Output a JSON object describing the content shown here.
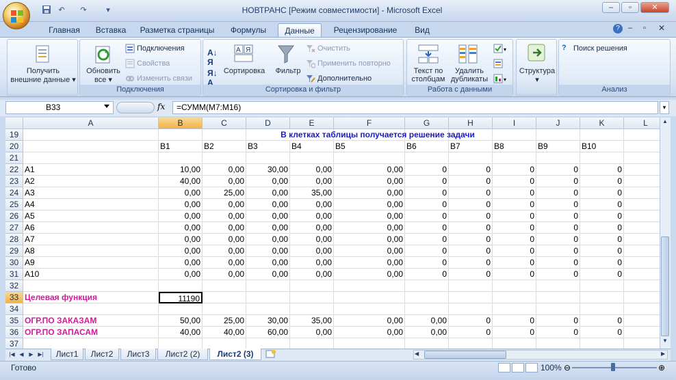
{
  "window": {
    "title": "НОВТРАНС  [Режим совместимости] - Microsoft Excel",
    "buttons": {
      "minimize": "–",
      "restore": "▫",
      "close": "✕"
    }
  },
  "ribbon": {
    "tabs": [
      "Главная",
      "Вставка",
      "Разметка страницы",
      "Формулы",
      "Данные",
      "Рецензирование",
      "Вид"
    ],
    "active_tab": "Данные",
    "groups": {
      "external": {
        "label": "",
        "get_data": "Получить",
        "get_data2": "внешние данные"
      },
      "connections": {
        "label": "Подключения",
        "refresh": "Обновить",
        "refresh2": "все",
        "connections": "Подключения",
        "properties": "Свойства",
        "edit_links": "Изменить связи"
      },
      "sort_filter": {
        "label": "Сортировка и фильтр",
        "sort": "Сортировка",
        "filter": "Фильтр",
        "clear": "Очистить",
        "reapply": "Применить повторно",
        "advanced": "Дополнительно"
      },
      "data_tools": {
        "label": "Работа с данными",
        "text_to_cols": "Текст по",
        "text_to_cols2": "столбцам",
        "remove_dup": "Удалить",
        "remove_dup2": "дубликаты"
      },
      "outline": {
        "label": "",
        "structure": "Структура"
      },
      "analysis": {
        "label": "Анализ",
        "solver": "Поиск решения"
      }
    },
    "help_icon": "help-icon"
  },
  "formula_bar": {
    "name_box": "B33",
    "fx": "fx",
    "formula": "=СУММ(M7:M16)"
  },
  "grid": {
    "columns": [
      "A",
      "B",
      "C",
      "D",
      "E",
      "F",
      "G",
      "H",
      "I",
      "J",
      "K",
      "L"
    ],
    "selected_column": "B",
    "selected_row": "33",
    "rows": [
      {
        "n": "19",
        "cells": {
          "D": "В  клетках таблицы получается решение задачи"
        }
      },
      {
        "n": "20",
        "cells": {
          "B": "В1",
          "C": "В2",
          "D": "В3",
          "E": "В4",
          "F": "В5",
          "G": "В6",
          "H": "В7",
          "I": "В8",
          "J": "В9",
          "K": "В10"
        }
      },
      {
        "n": "21",
        "cells": {}
      },
      {
        "n": "22",
        "cells": {
          "A": "А1",
          "B": "10,00",
          "C": "0,00",
          "D": "30,00",
          "E": "0,00",
          "F": "0,00",
          "G": "0",
          "H": "0",
          "I": "0",
          "J": "0",
          "K": "0"
        }
      },
      {
        "n": "23",
        "cells": {
          "A": "А2",
          "B": "40,00",
          "C": "0,00",
          "D": "0,00",
          "E": "0,00",
          "F": "0,00",
          "G": "0",
          "H": "0",
          "I": "0",
          "J": "0",
          "K": "0"
        }
      },
      {
        "n": "24",
        "cells": {
          "A": "А3",
          "B": "0,00",
          "C": "25,00",
          "D": "0,00",
          "E": "35,00",
          "F": "0,00",
          "G": "0",
          "H": "0",
          "I": "0",
          "J": "0",
          "K": "0"
        }
      },
      {
        "n": "25",
        "cells": {
          "A": "А4",
          "B": "0,00",
          "C": "0,00",
          "D": "0,00",
          "E": "0,00",
          "F": "0,00",
          "G": "0",
          "H": "0",
          "I": "0",
          "J": "0",
          "K": "0"
        }
      },
      {
        "n": "26",
        "cells": {
          "A": "А5",
          "B": "0,00",
          "C": "0,00",
          "D": "0,00",
          "E": "0,00",
          "F": "0,00",
          "G": "0",
          "H": "0",
          "I": "0",
          "J": "0",
          "K": "0"
        }
      },
      {
        "n": "27",
        "cells": {
          "A": "А6",
          "B": "0,00",
          "C": "0,00",
          "D": "0,00",
          "E": "0,00",
          "F": "0,00",
          "G": "0",
          "H": "0",
          "I": "0",
          "J": "0",
          "K": "0"
        }
      },
      {
        "n": "28",
        "cells": {
          "A": "А7",
          "B": "0,00",
          "C": "0,00",
          "D": "0,00",
          "E": "0,00",
          "F": "0,00",
          "G": "0",
          "H": "0",
          "I": "0",
          "J": "0",
          "K": "0"
        }
      },
      {
        "n": "29",
        "cells": {
          "A": "А8",
          "B": "0,00",
          "C": "0,00",
          "D": "0,00",
          "E": "0,00",
          "F": "0,00",
          "G": "0",
          "H": "0",
          "I": "0",
          "J": "0",
          "K": "0"
        }
      },
      {
        "n": "30",
        "cells": {
          "A": "А9",
          "B": "0,00",
          "C": "0,00",
          "D": "0,00",
          "E": "0,00",
          "F": "0,00",
          "G": "0",
          "H": "0",
          "I": "0",
          "J": "0",
          "K": "0"
        }
      },
      {
        "n": "31",
        "cells": {
          "A": "А10",
          "B": "0,00",
          "C": "0,00",
          "D": "0,00",
          "E": "0,00",
          "F": "0,00",
          "G": "0",
          "H": "0",
          "I": "0",
          "J": "0",
          "K": "0"
        }
      },
      {
        "n": "32",
        "cells": {}
      },
      {
        "n": "33",
        "cells": {
          "A": "Целевая функция",
          "B": "11190"
        }
      },
      {
        "n": "34",
        "cells": {}
      },
      {
        "n": "35",
        "cells": {
          "A": "ОГР.ПО ЗАКАЗАМ",
          "B": "50,00",
          "C": "25,00",
          "D": "30,00",
          "E": "35,00",
          "F": "0,00",
          "G": "0,00",
          "H": "0",
          "I": "0",
          "J": "0",
          "K": "0"
        }
      },
      {
        "n": "36",
        "cells": {
          "A": "ОГР.ПО ЗАПАСАМ",
          "B": "40,00",
          "C": "40,00",
          "D": "60,00",
          "E": "0,00",
          "F": "0,00",
          "G": "0,00",
          "H": "0",
          "I": "0",
          "J": "0",
          "K": "0"
        }
      },
      {
        "n": "37",
        "cells": {}
      }
    ]
  },
  "sheets": [
    "Лист1",
    "Лист2",
    "Лист3",
    "Лист2 (2)",
    "Лист2 (3)"
  ],
  "active_sheet": "Лист2 (3)",
  "status": {
    "text": "Готово",
    "zoom": "100%"
  },
  "colors": {
    "accent_pink": "#d4189a",
    "accent_blue": "#1b1bc4",
    "selection": "#f0b24a"
  }
}
